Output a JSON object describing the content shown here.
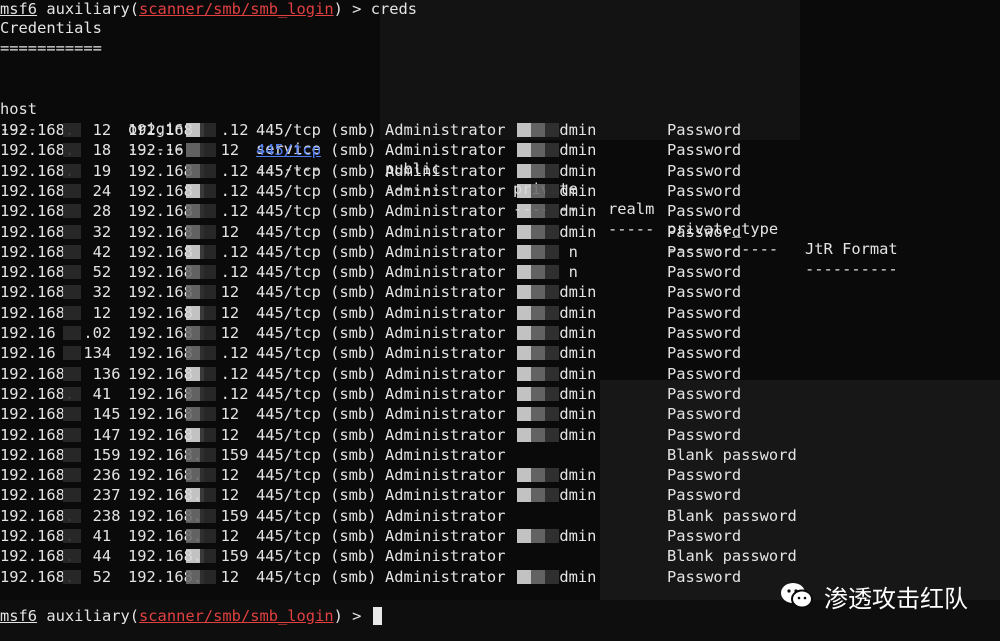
{
  "terminal": {
    "prompt_name": "msf6",
    "prompt_text": " auxiliary(",
    "module": "scanner/smb/smb_login",
    "prompt_end": ") > ",
    "command": "creds",
    "heading": "Credentials",
    "underline": "===========",
    "columns": {
      "host": "host",
      "origin": "origin",
      "service": "service",
      "public": "public",
      "private": "private",
      "realm": "realm",
      "private_type": "private_type",
      "jtr": "JtR Format"
    },
    "dashes": {
      "host": "----",
      "origin": "------",
      "service": "-------",
      "public": "------",
      "private": "-------",
      "realm": "-----",
      "private_type": "------------",
      "jtr": "----------"
    },
    "rows": [
      {
        "host": "192.168.  12",
        "origin": "192.168   .12",
        "service": "445/tcp (smb)",
        "public": "Administrator",
        "private": "     dmin",
        "type": "Password"
      },
      {
        "host": "192.168.  18",
        "origin": "192.16    12",
        "service": "445/tcp (smb)",
        "public": "Administrator",
        "private": "     dmin",
        "type": "Password"
      },
      {
        "host": "192.168.  19",
        "origin": "192.168   .12",
        "service": "445/tcp (smb)",
        "public": "Administrator",
        "private": "     dmin",
        "type": "Password"
      },
      {
        "host": "192.168   24",
        "origin": "192.168   .12",
        "service": "445/tcp (smb)",
        "public": "Administrator",
        "private": "     dmin",
        "type": "Password"
      },
      {
        "host": "192.168   28",
        "origin": "192.168   .12",
        "service": "445/tcp (smb)",
        "public": "Administrator",
        "private": "     dmin",
        "type": "Password"
      },
      {
        "host": "192.168   32",
        "origin": "192.168   12",
        "service": "445/tcp (smb)",
        "public": "Administrator",
        "private": "     dmin",
        "type": "Password"
      },
      {
        "host": "192.168   42",
        "origin": "192.168   .12",
        "service": "445/tcp (smb)",
        "public": "Administrator",
        "private": "      n",
        "type": "Password"
      },
      {
        "host": "192.168   52",
        "origin": "192.168   .12",
        "service": "445/tcp (smb)",
        "public": "Administrator",
        "private": "      n",
        "type": "Password"
      },
      {
        "host": "192.168   32",
        "origin": "192.168   12",
        "service": "445/tcp (smb)",
        "public": "Administrator",
        "private": "     dmin",
        "type": "Password"
      },
      {
        "host": "192.168   12",
        "origin": "192.168   12",
        "service": "445/tcp (smb)",
        "public": "Administrator",
        "private": "     dmin",
        "type": "Password"
      },
      {
        "host": "192.16   .02",
        "origin": "192.168   12",
        "service": "445/tcp (smb)",
        "public": "Administrator",
        "private": "     dmin",
        "type": "Password"
      },
      {
        "host": "192.16   134",
        "origin": "192.168   .12",
        "service": "445/tcp (smb)",
        "public": "Administrator",
        "private": "     dmin",
        "type": "Password"
      },
      {
        "host": "192.168   136",
        "origin": "192.168   .12",
        "service": "445/tcp (smb)",
        "public": "Administrator",
        "private": "     dmin",
        "type": "Password"
      },
      {
        "host": "192.168.  41",
        "origin": "192.168   .12",
        "service": "445/tcp (smb)",
        "public": "Administrator",
        "private": "     dmin",
        "type": "Password"
      },
      {
        "host": "192.168   145",
        "origin": "192.168   12",
        "service": "445/tcp (smb)",
        "public": "Administrator",
        "private": "     dmin",
        "type": "Password"
      },
      {
        "host": "192.168   147",
        "origin": "192.168   12",
        "service": "445/tcp (smb)",
        "public": "Administrator",
        "private": "     dmin",
        "type": "Password"
      },
      {
        "host": "192.168   159",
        "origin": "192.168.  159",
        "service": "445/tcp (smb)",
        "public": "Administrator",
        "private": "",
        "type": "Blank password"
      },
      {
        "host": "192.168   236",
        "origin": "192.168.  12",
        "service": "445/tcp (smb)",
        "public": "Administrator",
        "private": "     dmin",
        "type": "Password"
      },
      {
        "host": "192.168   237",
        "origin": "192.168.  12",
        "service": "445/tcp (smb)",
        "public": "Administrator",
        "private": "     dmin",
        "type": "Password"
      },
      {
        "host": "192.168.  238",
        "origin": "192.168.  159",
        "service": "445/tcp (smb)",
        "public": "Administrator",
        "private": "",
        "type": "Blank password"
      },
      {
        "host": "192.168.  41",
        "origin": "192.168.  12",
        "service": "445/tcp (smb)",
        "public": "Administrator",
        "private": "     dmin",
        "type": "Password"
      },
      {
        "host": "192.168.  44",
        "origin": "192.168.  159",
        "service": "445/tcp (smb)",
        "public": "Administrator",
        "private": "",
        "type": "Blank password"
      },
      {
        "host": "192.168.  52",
        "origin": "192.168.  12",
        "service": "445/tcp (smb)",
        "public": "Administrator",
        "private": "     dmin",
        "type": "Password"
      }
    ]
  },
  "watermark": {
    "text": "渗透攻击红队",
    "icon": "wechat-icon"
  },
  "colors": {
    "background": "#0a0a0a",
    "text": "#e4e4e4",
    "module_red": "#e04040",
    "link_blue": "#4f7df0"
  }
}
